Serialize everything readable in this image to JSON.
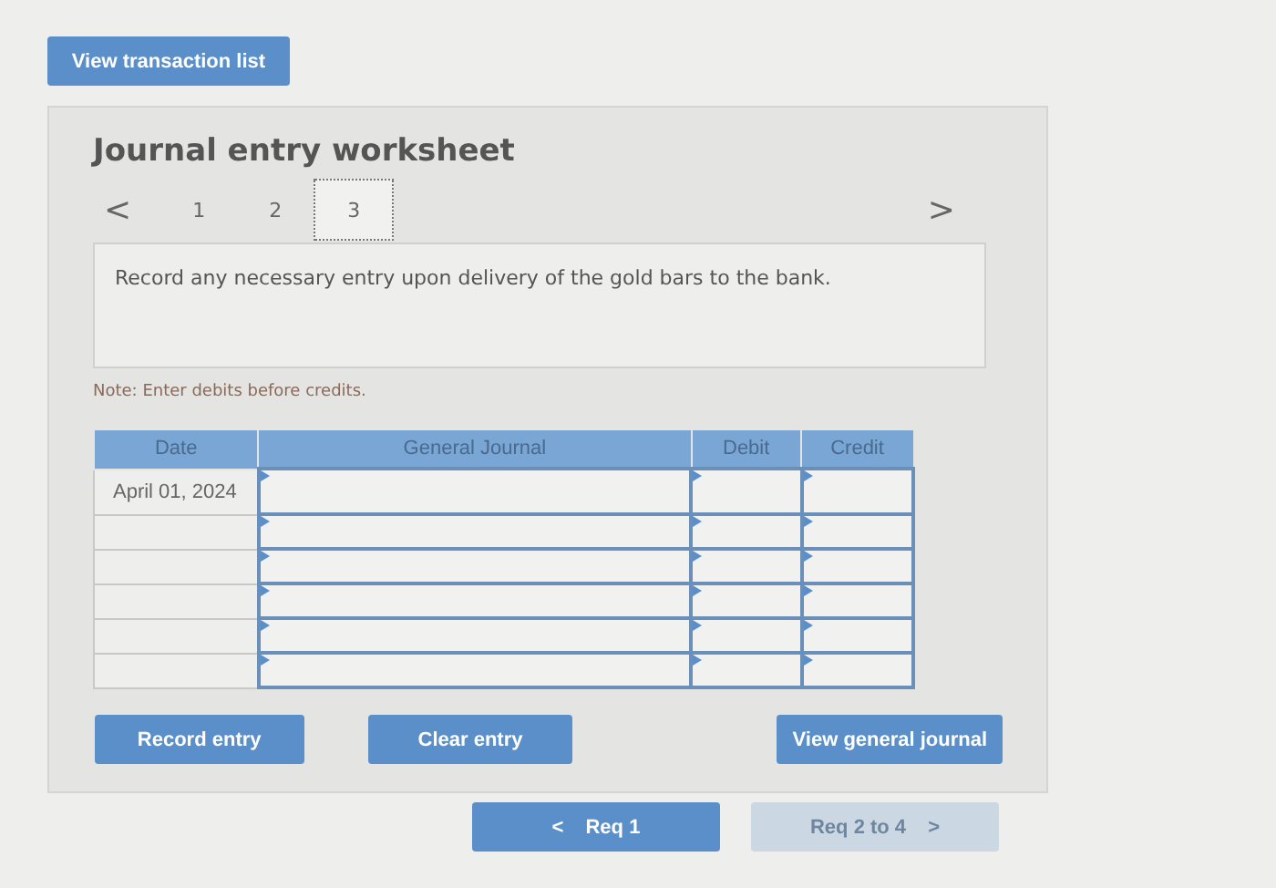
{
  "top_button": "View transaction list",
  "worksheet": {
    "title": "Journal entry worksheet",
    "prev": "<",
    "next": ">",
    "tabs": [
      {
        "label": "1",
        "selected": false
      },
      {
        "label": "2",
        "selected": false
      },
      {
        "label": "3",
        "selected": true
      }
    ],
    "prompt": "Record any necessary entry upon delivery of the gold bars to the bank.",
    "note": "Note: Enter debits before credits.",
    "table": {
      "columns": [
        "Date",
        "General Journal",
        "Debit",
        "Credit"
      ],
      "rows": [
        {
          "date": "April 01, 2024"
        },
        {},
        {},
        {},
        {},
        {}
      ]
    },
    "buttons": [
      "Record entry",
      "Clear entry",
      "View general journal"
    ]
  },
  "nav": [
    {
      "label": "Req 1",
      "arrow_left": "<",
      "disabled": false
    },
    {
      "label": "Req 2 to 4",
      "arrow_right": ">",
      "disabled": true
    }
  ]
}
